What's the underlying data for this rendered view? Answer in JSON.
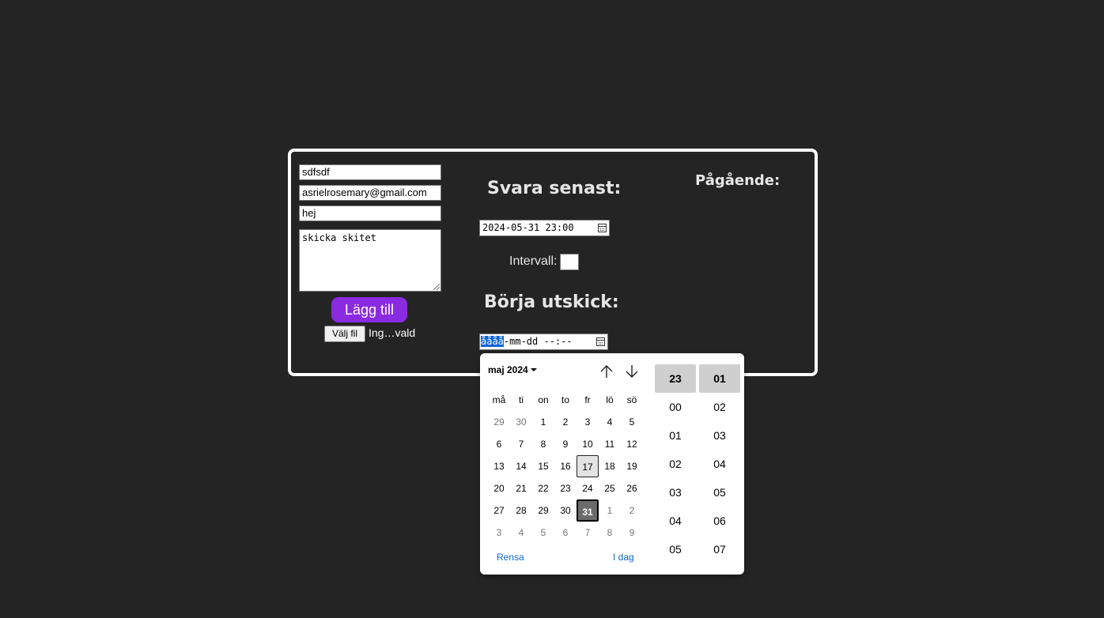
{
  "form": {
    "name_value": "sdfsdf",
    "email_value": "asrielrosemary@gmail.com",
    "subject_value": "hej",
    "message_value": "skicka skitet",
    "add_label": "Lägg till",
    "file_button_label": "Välj fil",
    "file_status": "Ing…vald"
  },
  "deadline": {
    "heading": "Svara senast:",
    "value": "2024-05-31 23:00"
  },
  "interval": {
    "label": "Intervall:"
  },
  "start": {
    "heading": "Börja utskick:",
    "year_placeholder": "åååå",
    "rest_placeholder": "-mm-dd --:--"
  },
  "ongoing": {
    "heading": "Pågående:"
  },
  "picker": {
    "month_label": "maj 2024",
    "weekdays": [
      "må",
      "ti",
      "on",
      "to",
      "fr",
      "lö",
      "sö"
    ],
    "weeks": [
      [
        "29",
        "30",
        "1",
        "2",
        "3",
        "4",
        "5"
      ],
      [
        "6",
        "7",
        "8",
        "9",
        "10",
        "11",
        "12"
      ],
      [
        "13",
        "14",
        "15",
        "16",
        "17",
        "18",
        "19"
      ],
      [
        "20",
        "21",
        "22",
        "23",
        "24",
        "25",
        "26"
      ],
      [
        "27",
        "28",
        "29",
        "30",
        "31",
        "1",
        "2"
      ],
      [
        "3",
        "4",
        "5",
        "6",
        "7",
        "8",
        "9"
      ]
    ],
    "today": "17",
    "selected": "31",
    "clear_label": "Rensa",
    "today_label": "I dag",
    "hours": [
      "23",
      "00",
      "01",
      "02",
      "03",
      "04",
      "05"
    ],
    "minutes": [
      "01",
      "02",
      "03",
      "04",
      "05",
      "06",
      "07"
    ],
    "selected_hour": "23",
    "selected_minute": "01",
    "icons": {
      "prev": "arrow-up-icon",
      "next": "arrow-down-icon",
      "calendar": "calendar-icon"
    }
  }
}
